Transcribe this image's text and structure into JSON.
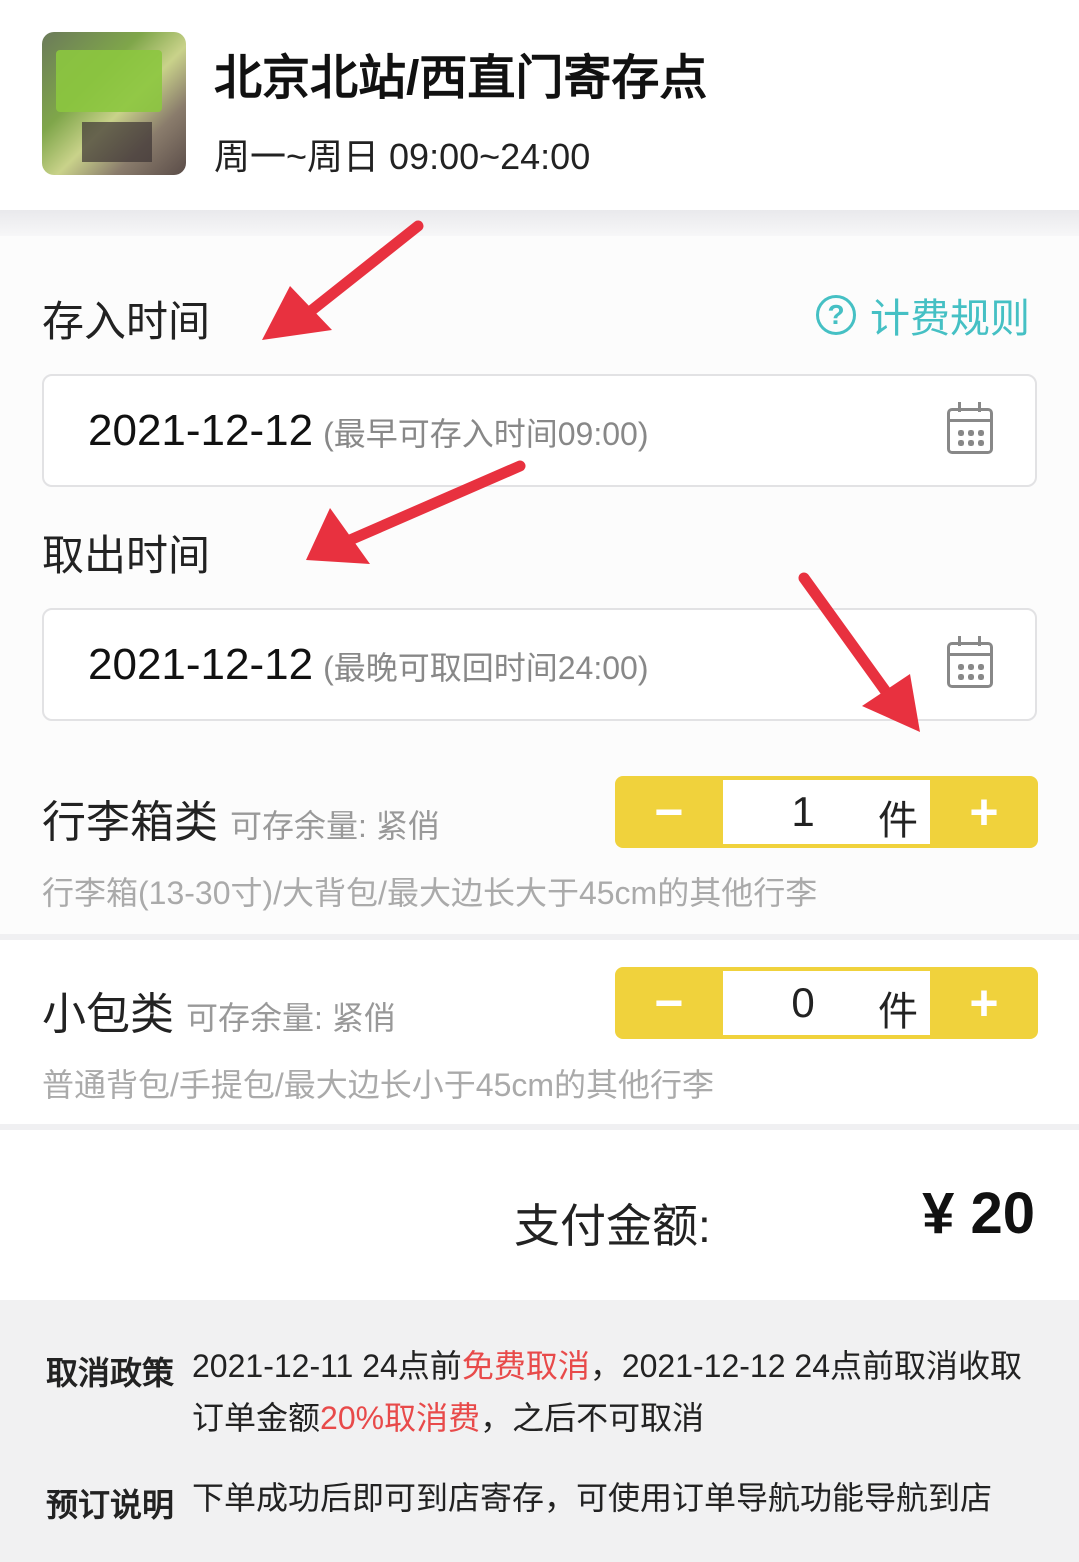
{
  "store": {
    "name": "北京北站/西直门寄存点",
    "hours": "周一~周日 09:00~24:00"
  },
  "checkin": {
    "label": "存入时间",
    "date": "2021-12-12",
    "hint": "(最早可存入时间09:00)"
  },
  "pricing_rules": {
    "icon": "?",
    "label": "计费规则"
  },
  "checkout": {
    "label": "取出时间",
    "date": "2021-12-12",
    "hint": "(最晚可取回时间24:00)"
  },
  "luggage": {
    "name": "行李箱类",
    "availability": "可存余量: 紧俏",
    "quantity": "1",
    "unit": "件",
    "description": "行李箱(13-30寸)/大背包/最大边长大于45cm的其他行李"
  },
  "small_bag": {
    "name": "小包类",
    "availability": "可存余量: 紧俏",
    "quantity": "0",
    "unit": "件",
    "description": "普通背包/手提包/最大边长小于45cm的其他行李"
  },
  "counter": {
    "minus": "−",
    "plus": "+"
  },
  "payment": {
    "label": "支付金额:",
    "amount": "¥ 20"
  },
  "policy": {
    "cancel_label": "取消政策",
    "cancel_part1": "2021-12-11 24点前",
    "cancel_free": "免费取消",
    "cancel_part2": "，2021-12-12 24点前取消收取订单金额",
    "cancel_fee": "20%取消费",
    "cancel_part3": "，之后不可取消",
    "booking_label": "预订说明",
    "booking_text": "下单成功后即可到店寄存，可使用订单导航功能导航到店"
  },
  "colors": {
    "accent_teal": "#45c0c4",
    "counter_yellow": "#f0d23c",
    "highlight_red": "#e84a4a",
    "annotation_arrow": "#e8313f"
  }
}
